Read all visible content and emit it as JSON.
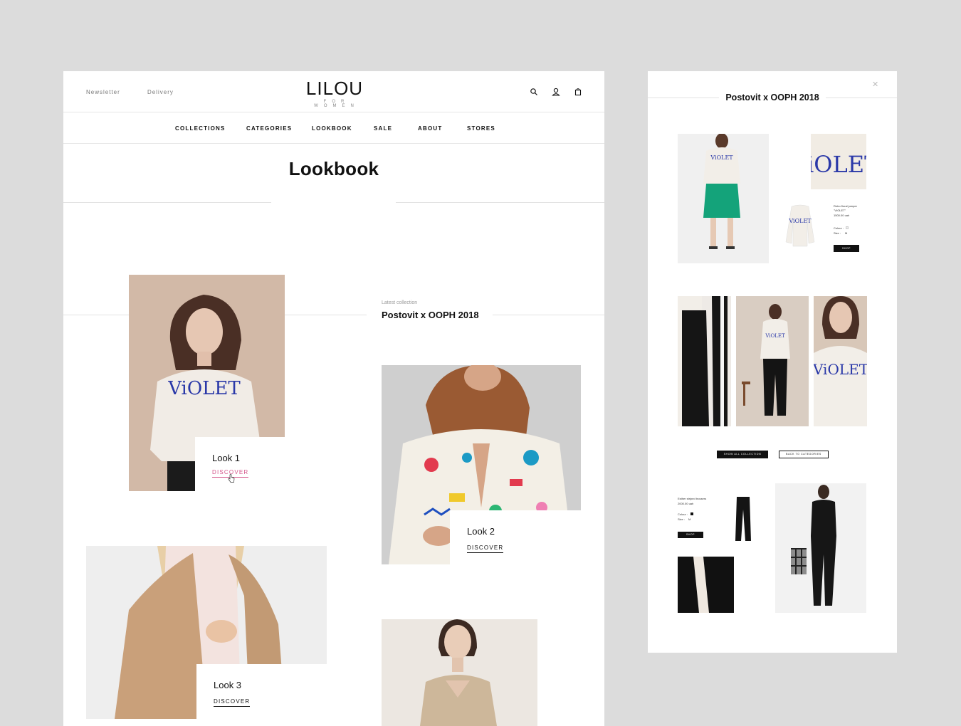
{
  "header": {
    "left_links": [
      "Newsletter",
      "Delivery"
    ],
    "logo": "LILOU",
    "logo_subtitle": "FOR WOMEN",
    "icons": [
      "search-icon",
      "user-icon",
      "bag-icon"
    ]
  },
  "nav": {
    "items": [
      "COLLECTIONS",
      "CATEGORIES",
      "LOOKBOOK",
      "SALE",
      "ABOUT",
      "STORES"
    ]
  },
  "page_title": "Lookbook",
  "latest_collection": {
    "label": "Latest collection",
    "name": "Postovit x OOPH 2018"
  },
  "looks": [
    {
      "title": "Look 1",
      "cta": "DISCOVER"
    },
    {
      "title": "Look 2",
      "cta": "DISCOVER"
    },
    {
      "title": "Look 3",
      "cta": "DISCOVER"
    }
  ],
  "sweater_print": "ViOLET",
  "modal": {
    "title": "Postovit x OOPH 2018",
    "close_icon": "close-icon",
    "product1": {
      "name": "Retro floral jumper",
      "name2": "\"VIOLET\"",
      "price": "1500.00 uah",
      "colour_label": "Colour :",
      "size_label": "Size :",
      "size": "M",
      "shop": "SHOP"
    },
    "buttons": {
      "show_all": "SHOW ALL COLLECTION",
      "back": "BACK TO CATEGORIES"
    },
    "product2": {
      "name": "Esther striped trousers",
      "price": "2000.00 uah",
      "colour_label": "Colour :",
      "size_label": "Size :",
      "size": "M",
      "shop": "SHOP"
    }
  },
  "colors": {
    "background": "#dcdcdc",
    "accent_pink": "#d4558a",
    "sweater_print_blue": "#2a38a8",
    "text": "#111111"
  }
}
